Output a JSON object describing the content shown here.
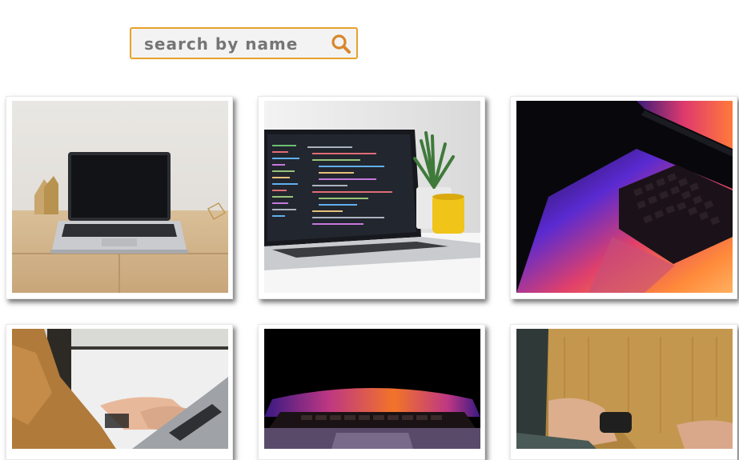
{
  "search": {
    "placeholder": "search by name",
    "value": "",
    "icon": "search-icon",
    "accent_color": "#e7a12b",
    "icon_color": "#d9862c"
  },
  "gallery": {
    "items": [
      {
        "subject": "laptop-on-wooden-desk"
      },
      {
        "subject": "laptop-with-code-and-plant"
      },
      {
        "subject": "laptop-keyboard-rainbow-light"
      },
      {
        "subject": "hands-typing-on-laptop"
      },
      {
        "subject": "laptop-glowing-dark"
      },
      {
        "subject": "person-in-sweater-with-laptop"
      }
    ]
  }
}
